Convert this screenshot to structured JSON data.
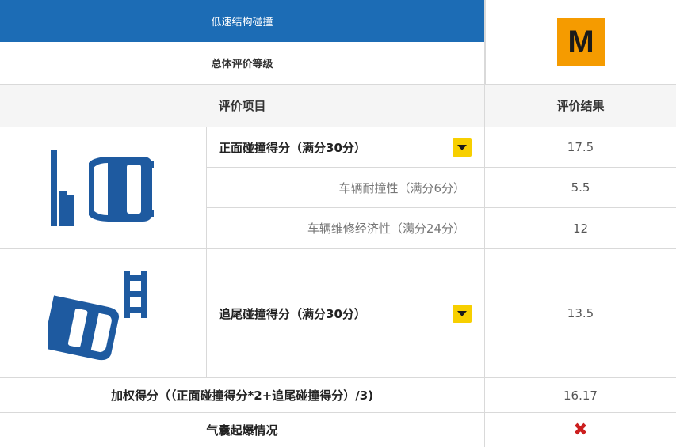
{
  "header": {
    "title": "低速结构碰撞",
    "overall_label": "总体评价等级",
    "grade": "M",
    "grade_color": "#f59b00",
    "header_color": "#1c6cb5"
  },
  "columns": {
    "item": "评价项目",
    "result": "评价结果"
  },
  "front": {
    "label": "正面碰撞得分（满分30分）",
    "value": "17.5",
    "sub": [
      {
        "label": "车辆耐撞性（满分6分）",
        "value": "5.5"
      },
      {
        "label": "车辆维修经济性（满分24分）",
        "value": "12"
      }
    ]
  },
  "rear": {
    "label": "追尾碰撞得分（满分30分）",
    "value": "13.5"
  },
  "weighted": {
    "label": "加权得分（（正面碰撞得分*2+追尾碰撞得分）/3)",
    "value": "16.17"
  },
  "airbag": {
    "label": "气囊起爆情况",
    "result_icon": "cross-icon",
    "result_symbol": "✖",
    "result_color": "#cc1f1f"
  }
}
